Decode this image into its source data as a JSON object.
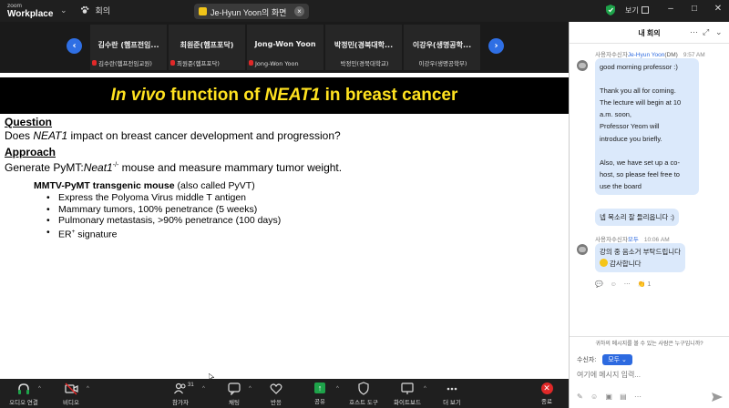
{
  "titlebar": {
    "brand_small": "zoom",
    "brand_large": "Workplace",
    "meeting_label": "회의",
    "share_label": "Je-Hyun Yoon의 화면",
    "view_label": "보기"
  },
  "participants": [
    {
      "display": "김수란 (헴프전임...",
      "sub": "김수란(헴프전임교원)",
      "muted": true
    },
    {
      "display": "최원준(헴프포닥)",
      "sub": "최원준(헴프포닥)",
      "muted": true
    },
    {
      "display": "Jong-Won Yoon",
      "sub": "Jong-Won Yoon",
      "muted": true
    },
    {
      "display": "박정민(경북대학...",
      "sub": "박정민(경북대학교)",
      "muted": false
    },
    {
      "display": "이강우(생명공학...",
      "sub": "이강우(생명공학부)",
      "muted": false
    }
  ],
  "slide": {
    "title_italic_1": "In vivo",
    "title_mid": " function of ",
    "title_italic_2": "NEAT1",
    "title_end": " in breast cancer",
    "question_head": "Question",
    "question_pre": "Does ",
    "question_em": "NEAT1",
    "question_post": " impact on breast cancer development and progression?",
    "approach_head": "Approach",
    "approach_pre": "Generate PyMT:",
    "approach_em": "Neat1",
    "approach_sup": "-/-",
    "approach_post": " mouse and measure mammary tumor weight.",
    "model_bold": "MMTV-PyMT transgenic mouse",
    "model_rest": " (also called PyVT)",
    "bullets": [
      "Express the Polyoma Virus middle T antigen",
      "Mammary tumors, 100% penetrance (5 weeks)",
      "Pulmonary metastasis, >90% penetrance (100 days)"
    ],
    "last_bullet_pre": "ER",
    "last_bullet_sup": "+",
    "last_bullet_post": " signature"
  },
  "chat": {
    "title": "내 회의",
    "msg1_sender": "사용자수신자",
    "msg1_to": "Je-Hyun Yoon",
    "msg1_dm": "(DM)",
    "msg1_time": "9:57 AM",
    "msg1_lines": [
      "good morning professor :)",
      "",
      "Thank you all for coming.",
      "The lecture will begin at 10",
      "a.m. soon,",
      "Professor Yeom will",
      "introduce you briefly.",
      "",
      "Also, we have set up a co-",
      "host, so please feel free to",
      "use the board"
    ],
    "msg2_text": "넵 목소리 잘 들리옵니다 :)",
    "msg3_sender": "사용자수신자",
    "msg3_to": "모두",
    "msg3_time": "10:06 AM",
    "msg3_line1": "강의 중 음소거 부탁드립니다",
    "msg3_line2": "감사합니다",
    "react_count": "1",
    "privacy_note": "귀하의 메시지를 볼 수 있는 사람은 누구입니까?",
    "to_label": "수신자:",
    "to_value": "모두",
    "input_placeholder": "여기에 메시지 입력..."
  },
  "toolbar": {
    "audio": "오디오 연결",
    "video": "비디오",
    "participants": "참가자",
    "participants_count": "31",
    "chat": "채팅",
    "react": "반응",
    "share": "공유",
    "host_tools": "호스트 도구",
    "whiteboard": "화이트보드",
    "more": "더 보기",
    "end": "종료"
  },
  "colors": {
    "accent": "#2d6ae0",
    "title_yellow": "#ffe21f",
    "bubble": "#dbe9fb",
    "end_red": "#e02828",
    "share_green": "#1ea34a"
  }
}
